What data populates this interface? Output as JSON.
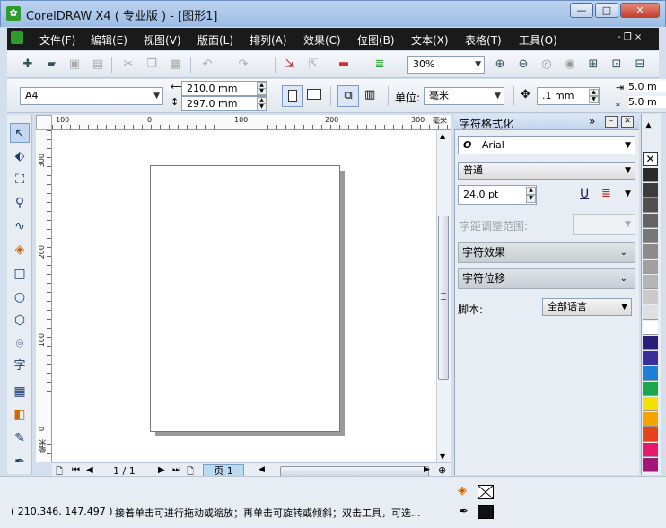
{
  "window": {
    "title": "CorelDRAW X4 ( 专业版 ) - [图形1]",
    "minimize": "—",
    "maximize": "□",
    "close": "✕"
  },
  "menu": {
    "items": [
      "文件(F)",
      "编辑(E)",
      "视图(V)",
      "版面(L)",
      "排列(A)",
      "效果(C)",
      "位图(B)",
      "文本(X)",
      "表格(T)",
      "工具(O)"
    ],
    "mdi_controls": "- ❐ ×"
  },
  "standard_toolbar": {
    "icons": [
      "new-icon",
      "open-icon",
      "save-icon",
      "print-icon",
      "cut-icon",
      "copy-icon",
      "paste-icon",
      "undo-icon",
      "redo-icon",
      "import-icon",
      "export-icon",
      "app-launcher-icon",
      "corel-online-icon"
    ],
    "zoom": "30%",
    "zoom_icons": [
      "zoom-in-icon",
      "zoom-out-icon",
      "zoom-selected-icon",
      "zoom-all-icon",
      "zoom-page-icon",
      "zoom-width-icon",
      "zoom-height-icon"
    ]
  },
  "property_bar": {
    "paper": "A4",
    "width": "210.0 mm",
    "height": "297.0 mm",
    "unit_label": "单位:",
    "unit": "毫米",
    "nudge": ".1 mm",
    "dup_x": "5.0 m",
    "dup_y": "5.0 m"
  },
  "toolbox": {
    "tools": [
      "pick-tool",
      "shape-tool",
      "crop-tool",
      "zoom-tool",
      "freehand-tool",
      "smart-fill-tool",
      "rectangle-tool",
      "ellipse-tool",
      "polygon-tool",
      "basic-shapes-tool",
      "text-tool",
      "table-tool",
      "interactive-tool",
      "eyedropper-tool",
      "outline-tool"
    ],
    "text_tool_label": "字"
  },
  "rulers": {
    "h_labels": [
      "100",
      "0",
      "100",
      "200",
      "300"
    ],
    "h_unit": "毫米",
    "v_labels": [
      "300",
      "200",
      "100",
      "0"
    ],
    "v_unit": "毫米"
  },
  "page_nav": {
    "counter": "1 / 1",
    "tab": "页 1"
  },
  "docker": {
    "title": "字符格式化",
    "font": "Arial",
    "style": "普通",
    "size": "24.0 pt",
    "range_label": "字距调整范围:",
    "effects_label": "字符效果",
    "shift_label": "字符位移",
    "script_label": "脚本:",
    "script_value": "全部语言"
  },
  "palette": {
    "colors": [
      "#2a2a2a",
      "#3c3c3c",
      "#4f4f4f",
      "#636363",
      "#777777",
      "#8b8b8b",
      "#a0a0a0",
      "#b5b5b5",
      "#cacaca",
      "#e0e0e0",
      "#ffffff",
      "#2b1e7a",
      "#3a2f99",
      "#1e7fd8",
      "#1aa64a",
      "#f4e100",
      "#f5a300",
      "#e8441b",
      "#e6196a",
      "#a21677"
    ]
  },
  "status": {
    "coords": "( 210.346, 147.497 )",
    "hint": "接着单击可进行拖动或缩放；再单击可旋转或倾斜；双击工具，可选..."
  }
}
